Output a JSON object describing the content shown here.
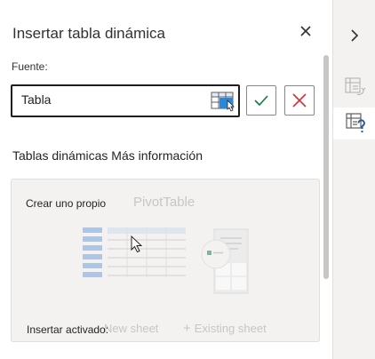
{
  "pane": {
    "title": "Insertar tabla dinámica",
    "close_icon": "close-icon"
  },
  "source": {
    "label": "Fuente:",
    "value": "Tabla",
    "range_icon": "table-range-select-icon"
  },
  "actions": {
    "confirm_icon": "checkmark-icon",
    "cancel_icon": "cancel-x-icon",
    "confirm_color": "#107c41",
    "cancel_color": "#d13438"
  },
  "section": {
    "heading": "Tablas dinámicas Más información"
  },
  "card": {
    "own_label": "Crear uno propio",
    "pivot_label": "PivotTable",
    "insert_label": "Insertar activado:",
    "new_sheet_label": "New sheet",
    "existing_sheet_label": "Existing sheet",
    "existing_plus": "+"
  },
  "rail": {
    "expand_icon": "chevron-right-icon",
    "items": [
      {
        "icon": "pivot-fields-icon"
      },
      {
        "icon": "pivot-help-icon"
      }
    ]
  },
  "colors": {
    "accent": "#2b579a",
    "excel_green": "#107c41"
  }
}
